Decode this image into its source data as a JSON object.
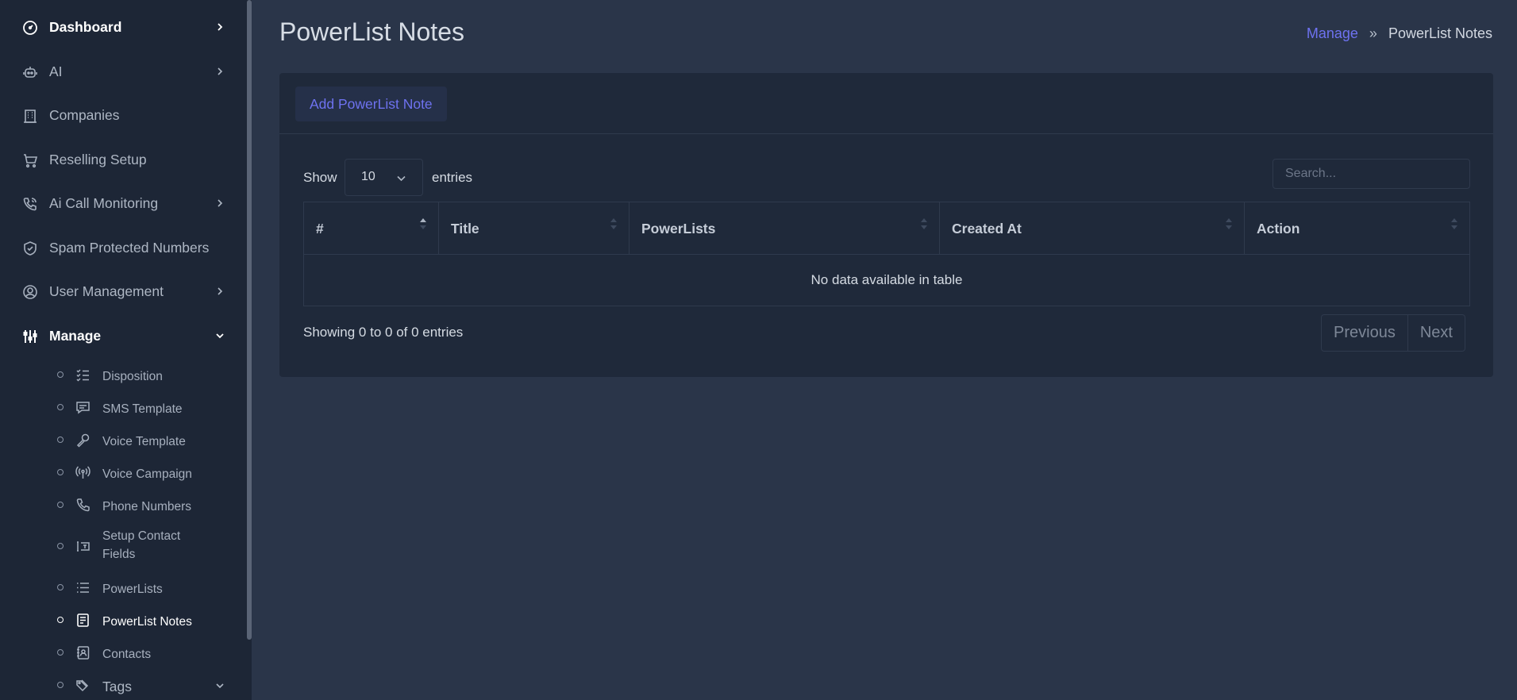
{
  "sidebar": {
    "items": [
      {
        "label": "Dashboard",
        "icon": "gauge-icon"
      },
      {
        "label": "AI",
        "icon": "robot-icon"
      },
      {
        "label": "Companies",
        "icon": "building-icon"
      },
      {
        "label": "Reselling Setup",
        "icon": "cart-icon"
      },
      {
        "label": "Ai Call Monitoring",
        "icon": "phone-call-icon"
      },
      {
        "label": "Spam Protected Numbers",
        "icon": "shield-check-icon"
      },
      {
        "label": "User Management",
        "icon": "user-circle-icon"
      },
      {
        "label": "Manage",
        "icon": "sliders-icon"
      }
    ],
    "manage_items": [
      {
        "label": "Disposition",
        "icon": "checklist-icon"
      },
      {
        "label": "SMS Template",
        "icon": "message-icon"
      },
      {
        "label": "Voice Template",
        "icon": "microphone-icon"
      },
      {
        "label": "Voice Campaign",
        "icon": "broadcast-icon"
      },
      {
        "label": "Phone Numbers",
        "icon": "phone-icon"
      },
      {
        "label": "Setup Contact Fields",
        "icon": "text-cursor-icon"
      },
      {
        "label": "PowerLists",
        "icon": "list-icon"
      },
      {
        "label": "PowerList Notes",
        "icon": "note-icon"
      },
      {
        "label": "Contacts",
        "icon": "address-book-icon"
      },
      {
        "label": "Tags",
        "icon": "tags-icon"
      }
    ]
  },
  "header": {
    "title": "PowerList Notes",
    "breadcrumb": {
      "parent": "Manage",
      "separator": "»",
      "current": "PowerList Notes"
    }
  },
  "card": {
    "add_button": "Add PowerList Note",
    "show_label": "Show",
    "entries_label": "entries",
    "page_length": "10",
    "search_placeholder": "Search...",
    "columns": [
      "#",
      "Title",
      "PowerLists",
      "Created At",
      "Action"
    ],
    "empty_message": "No data available in table",
    "info": "Showing 0 to 0 of 0 entries",
    "pagination": {
      "previous": "Previous",
      "next": "Next"
    }
  },
  "colors": {
    "accent": "#6e72f0",
    "sidebar_bg": "#1d2636",
    "page_bg": "#2a3549",
    "card_bg": "#1f293a"
  }
}
